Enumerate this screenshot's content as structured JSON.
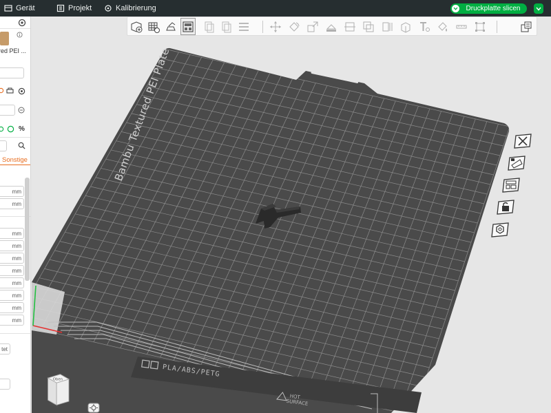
{
  "topbar": {
    "menus": [
      {
        "label": "Gerät",
        "icon": "device-icon"
      },
      {
        "label": "Projekt",
        "icon": "project-icon"
      },
      {
        "label": "Kalibrierung",
        "icon": "calibration-icon"
      }
    ],
    "slice_button_label": "Druckplatte slicen"
  },
  "left_panel": {
    "plate_type_label": "red PEI ...",
    "tab_others": "Sonstige",
    "fields_a": [
      "mm",
      "mm"
    ],
    "fields_b": [
      "mm",
      "mm",
      "mm",
      "mm",
      "mm",
      "mm",
      "mm",
      "mm"
    ],
    "partial_field": "tet",
    "percent_label": "%"
  },
  "plate": {
    "brand_text": "Bambu Textured PEI Plate",
    "material_text": "PLA/ABS/PETG",
    "hot_text_1": "HOT",
    "hot_text_2": "SURFACE"
  },
  "viewcube": {
    "top_label": "Oben",
    "front_label": "Vorne"
  },
  "colors": {
    "accent": "#00ae42",
    "topbar_bg": "#262e30",
    "plate": "#4a4a4a",
    "grid": "#8c8c8c",
    "canvas_bg": "#e6e6e6",
    "orange_tab": "#e86c1e"
  },
  "toolbar_icons": [
    "add-object-icon",
    "add-plate-icon",
    "auto-orient-icon",
    "arrange-icon",
    "split-objects-icon",
    "split-parts-icon",
    "layers-icon",
    "move-icon",
    "rotate-icon",
    "scale-icon",
    "lay-on-face-icon",
    "cut-icon",
    "mesh-boolean-icon",
    "support-paint-icon",
    "seam-paint-icon",
    "text-emboss-icon",
    "color-paint-icon",
    "measure-icon",
    "assembly-icon",
    "variable-layer-icon"
  ],
  "side_buttons": [
    "remove-plate-icon",
    "arrange-plate-icon",
    "plate-settings-icon",
    "lock-plate-icon",
    "plate-gear-icon"
  ]
}
